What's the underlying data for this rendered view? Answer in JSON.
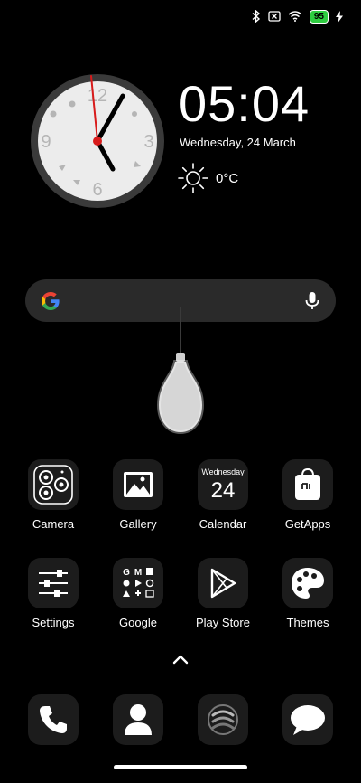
{
  "status_bar": {
    "battery": "95"
  },
  "widget": {
    "time": "05:04",
    "date": "Wednesday, 24 March",
    "temperature": "0°C",
    "clock_numerals": [
      "12",
      "3",
      "6",
      "9"
    ]
  },
  "apps": [
    {
      "label": "Camera"
    },
    {
      "label": "Gallery"
    },
    {
      "label": "Calendar",
      "weekday": "Wednesday",
      "day": "24"
    },
    {
      "label": "GetApps"
    },
    {
      "label": "Settings"
    },
    {
      "label": "Google"
    },
    {
      "label": "Play Store"
    },
    {
      "label": "Themes"
    }
  ],
  "dock": [
    "phone-icon",
    "contacts-icon",
    "browser-icon",
    "messages-icon"
  ],
  "colors": {
    "background": "#000000",
    "search_bar": "#2a2a2a",
    "battery": "#2ecc40",
    "second_hand": "#d81b1b"
  }
}
